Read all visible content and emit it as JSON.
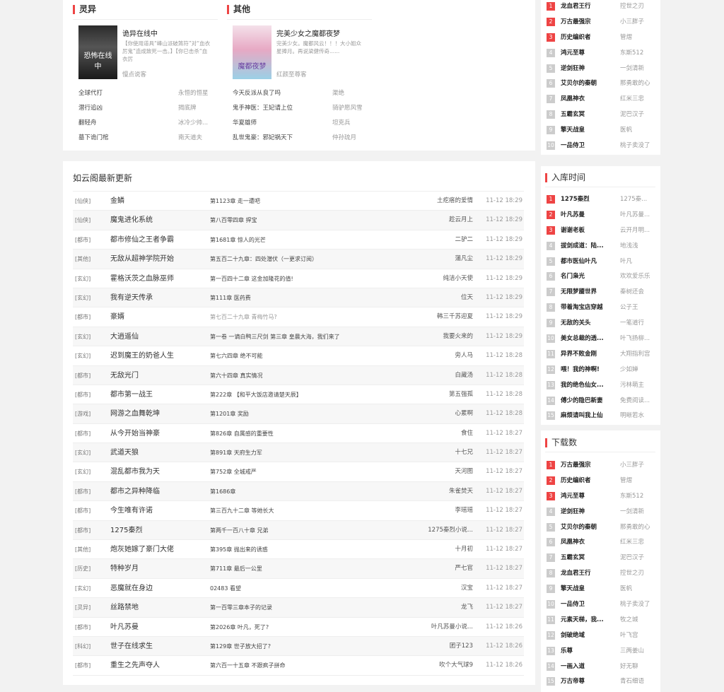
{
  "categories": [
    {
      "title": "灵异",
      "featured": {
        "name": "诡异在线中",
        "desc": "【你使用道具“峰山派破煞符”对“血衣厉鬼”造成致死一击。】【你已击杀“血衣厉",
        "author": "慢点说客",
        "cover_text": "恐怖在线中"
      },
      "rows": [
        {
          "name": "全球代打",
          "author": "永恒的恒星"
        },
        {
          "name": "潜行追凶",
          "author": "揭底牌"
        },
        {
          "name": "翻轻舟",
          "author": "冰冷少帅..."
        },
        {
          "name": "墓下诡门棺",
          "author": "南天道夫"
        }
      ]
    },
    {
      "title": "其他",
      "featured": {
        "name": "完美少女之魔都夜梦",
        "desc": "完美少女。魔都风云！！！大小姐众星捧月。再说梁健传奇......",
        "author": "红颜至尊客",
        "cover_text": "魔都夜梦"
      },
      "rows": [
        {
          "name": "今天反派从良了吗",
          "author": "渠绝"
        },
        {
          "name": "鬼手神医：王妃请上位",
          "author": "骑驴愿风雪"
        },
        {
          "name": "华夏雄师",
          "author": "坦克兵"
        },
        {
          "name": "乱世鬼豪：邪妃祸天下",
          "author": "仲孙琉月"
        }
      ]
    }
  ],
  "updates": {
    "title": "如云阁最新更新",
    "rows": [
      {
        "cat": "[仙侠]",
        "book": "金鳞",
        "chapter": "第1123章 走一遭吧",
        "author": "土疙瘩的爱情",
        "time": "11-12 18:29"
      },
      {
        "cat": "[仙侠]",
        "book": "魔鬼进化系统",
        "chapter": "第八百零四章 捍宝",
        "author": "趁云月上",
        "time": "11-12 18:29"
      },
      {
        "cat": "[都市]",
        "book": "都市修仙之王者争霸",
        "chapter": "第1681章 惊人的光芒",
        "author": "二驴二",
        "time": "11-12 18:29"
      },
      {
        "cat": "[其他]",
        "book": "无敌从超神学院开始",
        "chapter": "第五百二十九章：四处潜伏（一更求订阅）",
        "author": "蒲凡尘",
        "time": "11-12 18:29"
      },
      {
        "cat": "[玄幻]",
        "book": "霍格沃茨之血脉巫师",
        "chapter": "第一百四十二章 这金加隆花的值!",
        "author": "纯洁小天使",
        "time": "11-12 18:29"
      },
      {
        "cat": "[玄幻]",
        "book": "我有逆天传承",
        "chapter": "第111章 医药费",
        "author": "位天",
        "time": "11-12 18:29"
      },
      {
        "cat": "[都市]",
        "book": "豪婿",
        "chapter": "第七百二十九章 青梅竹马?",
        "author": "韩三千苏迎夏",
        "time": "11-12 18:29"
      },
      {
        "cat": "[玄幻]",
        "book": "大逍遥仙",
        "chapter": "第一卷 一谪白鸭三尺剑 第三章 皇晨大海，我们来了",
        "author": "我要火来的",
        "time": "11-12 18:29"
      },
      {
        "cat": "[玄幻]",
        "book": "迟到魔王的奶爸人生",
        "chapter": "第七六四章 绝不可能",
        "author": "旁人马",
        "time": "11-12 18:28"
      },
      {
        "cat": "[都市]",
        "book": "无敌光门",
        "chapter": "第六十四章 真实情况",
        "author": "白藏汤",
        "time": "11-12 18:28"
      },
      {
        "cat": "[都市]",
        "book": "都市第一战王",
        "chapter": "第222章 【和平大饭店邀请楚天辰】",
        "author": "第五强孤",
        "time": "11-12 18:28"
      },
      {
        "cat": "[游戏]",
        "book": "网游之血舞乾坤",
        "chapter": "第1201章 奖励",
        "author": "心累啊",
        "time": "11-12 18:28"
      },
      {
        "cat": "[都市]",
        "book": "从今开始当神豪",
        "chapter": "第826章 自属感的重要性",
        "author": "食住",
        "time": "11-12 18:27"
      },
      {
        "cat": "[玄幻]",
        "book": "武道天狼",
        "chapter": "第891章 天府生力军",
        "author": "十七兄",
        "time": "11-12 18:27"
      },
      {
        "cat": "[玄幻]",
        "book": "混乱都市我为天",
        "chapter": "第752章 全城戒严",
        "author": "天河图",
        "time": "11-12 18:27"
      },
      {
        "cat": "[都市]",
        "book": "都市之异种降临",
        "chapter": "第1686章",
        "author": "朱雀焚天",
        "time": "11-12 18:27"
      },
      {
        "cat": "[都市]",
        "book": "今生唯有许诺",
        "chapter": "第三百九十二章 等她长大",
        "author": "李瑶瑶",
        "time": "11-12 18:27"
      },
      {
        "cat": "[都市]",
        "book": "1275秦烈",
        "chapter": "第两千一百八十章 兄弟",
        "author": "1275秦烈小说...",
        "time": "11-12 18:27"
      },
      {
        "cat": "[其他]",
        "book": "炮灰她嫁了豪门大佬",
        "chapter": "第395章 抛出来的诱惑",
        "author": "十月初",
        "time": "11-12 18:27"
      },
      {
        "cat": "[历史]",
        "book": "特种岁月",
        "chapter": "第711章 最后一公里",
        "author": "严七官",
        "time": "11-12 18:27"
      },
      {
        "cat": "[玄幻]",
        "book": "恶魔就在身边",
        "chapter": "02483 看望",
        "author": "汉宝",
        "time": "11-12 18:27"
      },
      {
        "cat": "[灵异]",
        "book": "丝路禁地",
        "chapter": "第一百零三章本子的记录",
        "author": "龙飞",
        "time": "11-12 18:27"
      },
      {
        "cat": "[都市]",
        "book": "叶凡苏曼",
        "chapter": "第2026章 叶凡，死了?",
        "author": "叶凡苏曼小说...",
        "time": "11-12 18:26"
      },
      {
        "cat": "[科幻]",
        "book": "世子在线求生",
        "chapter": "第129章 世子放大招了?",
        "author": "团子123",
        "time": "11-12 18:26"
      },
      {
        "cat": "[都市]",
        "book": "重生之先声夺人",
        "chapter": "第六百一十五章 不跟疯子拼命",
        "author": "吹个大气球9",
        "time": "11-12 18:26"
      }
    ]
  },
  "rank_top": {
    "items": [
      {
        "num": "1",
        "book": "龙血君王行",
        "author": "控世之刃"
      },
      {
        "num": "2",
        "book": "万古最强宗",
        "author": "小三胖子"
      },
      {
        "num": "3",
        "book": "历史编织者",
        "author": "管熠"
      },
      {
        "num": "4",
        "book": "鸿元至尊",
        "author": "东斯512"
      },
      {
        "num": "5",
        "book": "逆剑狂神",
        "author": "一剑清新"
      },
      {
        "num": "6",
        "book": "艾贝尔的秦朝",
        "author": "那勇敢的心"
      },
      {
        "num": "7",
        "book": "凤凰神衣",
        "author": "红米三忠"
      },
      {
        "num": "8",
        "book": "五霸玄冥",
        "author": "泥巴汉子"
      },
      {
        "num": "9",
        "book": "擎天战皇",
        "author": "医帆"
      },
      {
        "num": "10",
        "book": "一品侍卫",
        "author": "桃子卖没了"
      }
    ]
  },
  "rank_new": {
    "title": "入库时间",
    "items": [
      {
        "num": "1",
        "book": "1275秦烈",
        "author": "1275秦..."
      },
      {
        "num": "2",
        "book": "叶凡苏曼",
        "author": "叶凡苏曼..."
      },
      {
        "num": "3",
        "book": "谢谢老板",
        "author": "云开月明..."
      },
      {
        "num": "4",
        "book": "拔剑成道：陆...",
        "author": "地浅浅"
      },
      {
        "num": "5",
        "book": "都市医仙叶凡",
        "author": "叶凡"
      },
      {
        "num": "6",
        "book": "名门枭光",
        "author": "欢欢爱乐乐"
      },
      {
        "num": "7",
        "book": "无限梦靥世界",
        "author": "秦树还会"
      },
      {
        "num": "8",
        "book": "带着淘宝店穿越",
        "author": "公子王"
      },
      {
        "num": "9",
        "book": "无敌的关头",
        "author": "一笔道行"
      },
      {
        "num": "10",
        "book": "美女总裁的透...",
        "author": "叶飞扬柳..."
      },
      {
        "num": "11",
        "book": "异界不败金刚",
        "author": "大翔指利宫"
      },
      {
        "num": "12",
        "book": "喂！我的神啊!",
        "author": "少如婵"
      },
      {
        "num": "13",
        "book": "我的绝色仙女...",
        "author": "污林萌主"
      },
      {
        "num": "14",
        "book": "傅少的隐巴新妻",
        "author": "免费阅读..."
      },
      {
        "num": "15",
        "book": "麻烦请叫我上仙",
        "author": "明晰若水"
      }
    ]
  },
  "rank_download": {
    "title": "下载数",
    "items": [
      {
        "num": "1",
        "book": "万古最强宗",
        "author": "小三胖子"
      },
      {
        "num": "2",
        "book": "历史编织者",
        "author": "管熠"
      },
      {
        "num": "3",
        "book": "鸿元至尊",
        "author": "东斯512"
      },
      {
        "num": "4",
        "book": "逆剑狂神",
        "author": "一剑清新"
      },
      {
        "num": "5",
        "book": "艾贝尔的秦朝",
        "author": "那勇敢的心"
      },
      {
        "num": "6",
        "book": "凤凰神衣",
        "author": "红米三忠"
      },
      {
        "num": "7",
        "book": "五霸玄冥",
        "author": "泥巴汉子"
      },
      {
        "num": "8",
        "book": "龙血君王行",
        "author": "控世之刃"
      },
      {
        "num": "9",
        "book": "擎天战皇",
        "author": "医帆"
      },
      {
        "num": "10",
        "book": "一品侍卫",
        "author": "桃子卖没了"
      },
      {
        "num": "11",
        "book": "元素天梯，我...",
        "author": "牧之城"
      },
      {
        "num": "12",
        "book": "剑破绝域",
        "author": "叶飞宫"
      },
      {
        "num": "13",
        "book": "乐尊",
        "author": "三两姜山"
      },
      {
        "num": "14",
        "book": "一画入道",
        "author": "好无聊"
      },
      {
        "num": "15",
        "book": "万古帝尊",
        "author": "青石细语"
      }
    ]
  },
  "colors": {
    "accent": "#e44444",
    "rank_gray": "#cccccc",
    "bg": "#f2f2f2"
  }
}
